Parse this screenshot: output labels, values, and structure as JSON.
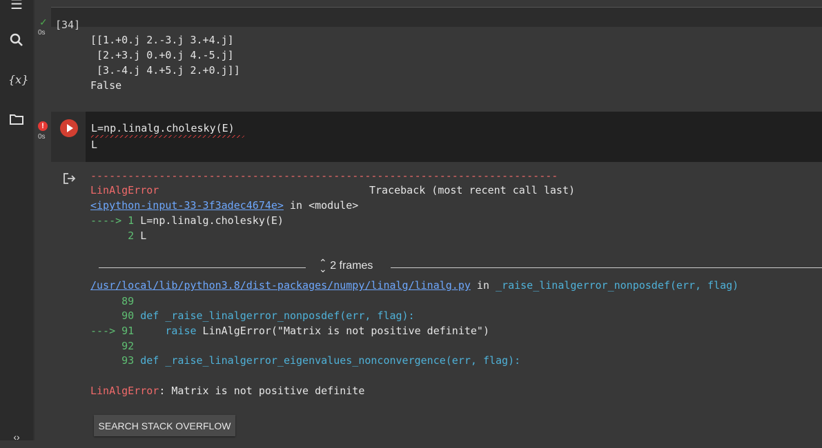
{
  "sidebar": {
    "items": [
      {
        "name": "table-of-contents-icon",
        "glyph": "☰"
      },
      {
        "name": "search-icon",
        "glyph": "⌕"
      },
      {
        "name": "variables-icon",
        "glyph": "{x}"
      },
      {
        "name": "files-icon",
        "glyph": "▭"
      }
    ],
    "bottom_glyph": "‹›"
  },
  "cell1": {
    "exec_count": "[34]",
    "time": "0s",
    "output_lines": [
      "[[1.+0.j 2.-3.j 3.+4.j]",
      " [2.+3.j 0.+0.j 4.-5.j]",
      " [3.-4.j 4.+5.j 2.+0.j]]",
      "False"
    ]
  },
  "cell2": {
    "time": "0s",
    "code_line1": "L=np.linalg.cholesky(E)",
    "code_line2": "L"
  },
  "traceback": {
    "dash_line": "---------------------------------------------------------------------------",
    "error_name": "LinAlgError",
    "header_right": "Traceback (most recent call last)",
    "input_link": "<ipython-input-33-3f3adec4674e>",
    "in_module": " in <module>",
    "arrow1": "----> 1",
    "line1_code": " L=np.linalg.cholesky(E)",
    "line2_num": "      2",
    "line2_code": " L",
    "frames_label": "2 frames",
    "file_link": "/usr/local/lib/python3.8/dist-packages/numpy/linalg/linalg.py",
    "file_in": " in ",
    "file_func": "_raise_linalgerror_nonposdef(err, flag)",
    "l89": "     89",
    "l90": "     90",
    "l90_code": " def _raise_linalgerror_nonposdef(err, flag):",
    "l91_arrow": "---> 91",
    "l91_code_kw": "     raise",
    "l91_code_rest": " LinAlgError(\"Matrix is not positive definite\")",
    "l92": "     92",
    "l93": "     93",
    "l93_code": " def _raise_linalgerror_eigenvalues_nonconvergence(err, flag):",
    "final_error_name": "LinAlgError",
    "final_message": ": Matrix is not positive definite"
  },
  "buttons": {
    "search_stack_overflow": "SEARCH STACK OVERFLOW"
  },
  "colors": {
    "error_red": "#f06a6a",
    "line_number_green": "#5fbf73",
    "link_blue": "#6ea8fe",
    "run_button_red": "#d23f31"
  }
}
